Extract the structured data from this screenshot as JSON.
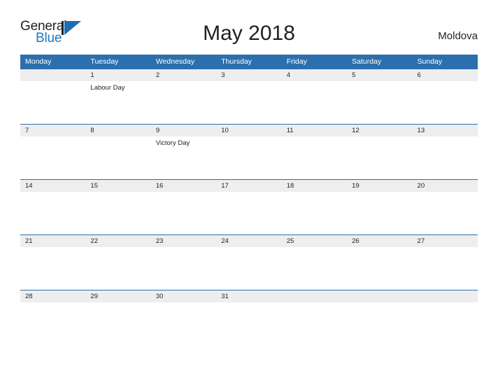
{
  "brand": {
    "name_part1": "General",
    "name_part2": "Blue",
    "mark_icon": "triangle-flag-icon",
    "color_dark": "#221f20",
    "color_blue": "#1a7ac4"
  },
  "header": {
    "title": "May 2018",
    "region": "Moldova"
  },
  "theme": {
    "header_blue": "#2c6fae",
    "band_gray": "#eeeeee",
    "text": "#231f20"
  },
  "calendar": {
    "weekday_headers": [
      "Monday",
      "Tuesday",
      "Wednesday",
      "Thursday",
      "Friday",
      "Saturday",
      "Sunday"
    ],
    "weeks": [
      [
        {
          "day": "",
          "events": []
        },
        {
          "day": "1",
          "events": [
            "Labour Day"
          ]
        },
        {
          "day": "2",
          "events": []
        },
        {
          "day": "3",
          "events": []
        },
        {
          "day": "4",
          "events": []
        },
        {
          "day": "5",
          "events": []
        },
        {
          "day": "6",
          "events": []
        }
      ],
      [
        {
          "day": "7",
          "events": []
        },
        {
          "day": "8",
          "events": []
        },
        {
          "day": "9",
          "events": [
            "Victory Day"
          ]
        },
        {
          "day": "10",
          "events": []
        },
        {
          "day": "11",
          "events": []
        },
        {
          "day": "12",
          "events": []
        },
        {
          "day": "13",
          "events": []
        }
      ],
      [
        {
          "day": "14",
          "events": []
        },
        {
          "day": "15",
          "events": []
        },
        {
          "day": "16",
          "events": []
        },
        {
          "day": "17",
          "events": []
        },
        {
          "day": "18",
          "events": []
        },
        {
          "day": "19",
          "events": []
        },
        {
          "day": "20",
          "events": []
        }
      ],
      [
        {
          "day": "21",
          "events": []
        },
        {
          "day": "22",
          "events": []
        },
        {
          "day": "23",
          "events": []
        },
        {
          "day": "24",
          "events": []
        },
        {
          "day": "25",
          "events": []
        },
        {
          "day": "26",
          "events": []
        },
        {
          "day": "27",
          "events": []
        }
      ],
      [
        {
          "day": "28",
          "events": []
        },
        {
          "day": "29",
          "events": []
        },
        {
          "day": "30",
          "events": []
        },
        {
          "day": "31",
          "events": []
        },
        {
          "day": "",
          "events": []
        },
        {
          "day": "",
          "events": []
        },
        {
          "day": "",
          "events": []
        }
      ]
    ]
  }
}
